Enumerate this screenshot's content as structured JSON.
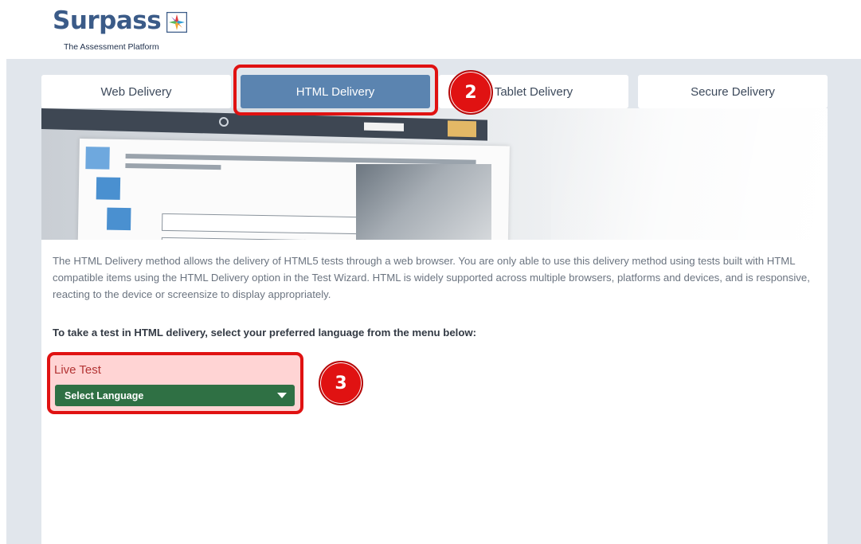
{
  "header": {
    "logo_text": "Surpass",
    "logo_subtitle": "The Assessment Platform",
    "logo_icon": "surpass-logo-icon"
  },
  "tabs": [
    {
      "label": "Web Delivery",
      "active": false
    },
    {
      "label": "HTML Delivery",
      "active": true
    },
    {
      "label": "Tablet Delivery",
      "active": false
    },
    {
      "label": "Secure Delivery",
      "active": false
    }
  ],
  "callouts": {
    "step_2": "2",
    "step_3": "3"
  },
  "content": {
    "description": "The HTML Delivery method allows the delivery of HTML5 tests through a web browser. You are only able to use this delivery method using tests built with HTML compatible items using the HTML Delivery option in the Test Wizard. HTML is widely supported across multiple browsers, platforms and devices, and is responsive, reacting to the device or screensize to display appropriately.",
    "instruction": "To take a test in HTML delivery, select your preferred language from the menu below:",
    "live_test_label": "Live Test",
    "language_select": "Select Language"
  },
  "colors": {
    "active_tab": "#5b84b0",
    "highlight": "#e01212",
    "select_bg": "#2f7044",
    "page_bg": "#e1e6ec"
  }
}
